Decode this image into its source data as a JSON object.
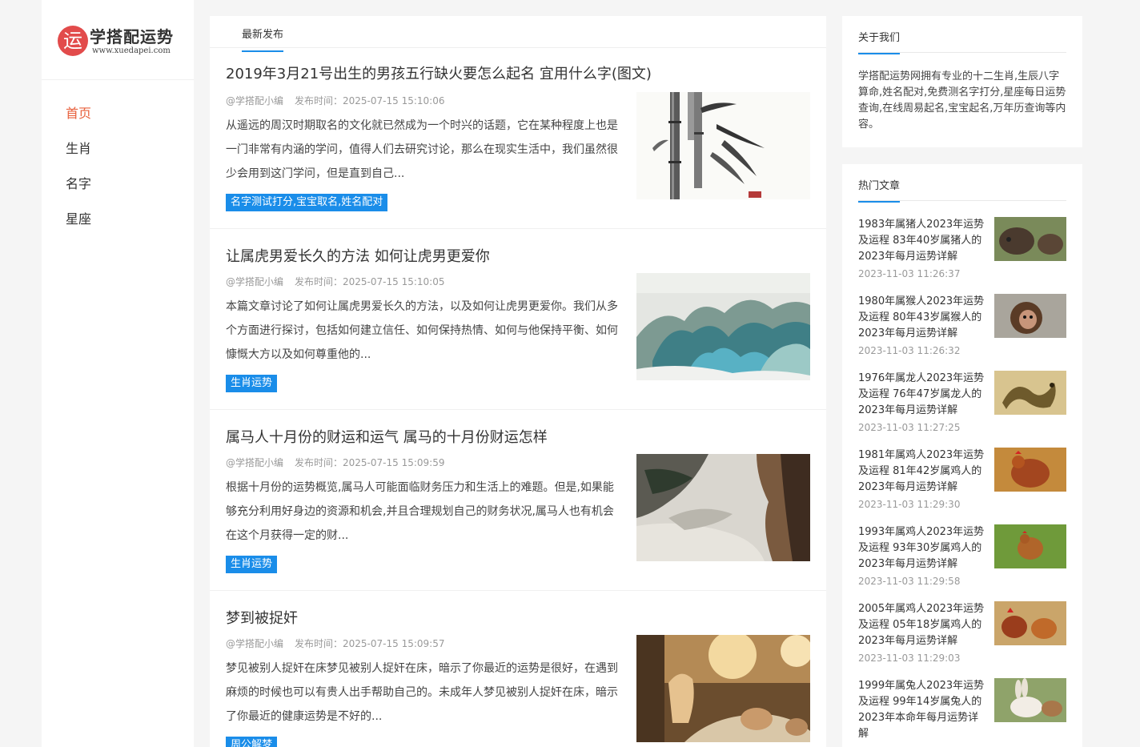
{
  "logo": {
    "badge": "运",
    "title": "学搭配运势",
    "subtitle": "www.xuedapei.com"
  },
  "nav": [
    {
      "label": "首页",
      "active": true
    },
    {
      "label": "生肖",
      "active": false
    },
    {
      "label": "名字",
      "active": false
    },
    {
      "label": "星座",
      "active": false
    }
  ],
  "main": {
    "tab": "最新发布",
    "articles": [
      {
        "title": "2019年3月21号出生的男孩五行缺火要怎么起名 宜用什么字(图文)",
        "author": "@学搭配小编",
        "time": "发布时间：2025-07-15 15:10:06",
        "excerpt": "从遥远的周汉时期取名的文化就已然成为一个时兴的话题，它在某种程度上也是一门非常有内涵的学问，值得人们去研究讨论，那么在现实生活中，我们虽然很少会用到这门学问，但是直到自己...",
        "tag": "名字测试打分,宝宝取名,姓名配对",
        "image": "bamboo-ink-painting"
      },
      {
        "title": "让属虎男爱长久的方法 如何让虎男更爱你",
        "author": "@学搭配小编",
        "time": "发布时间：2025-07-15 15:10:05",
        "excerpt": "本篇文章讨论了如何让属虎男爱长久的方法，以及如何让虎男更爱你。我们从多个方面进行探讨，包括如何建立信任、如何保持热情、如何与他保持平衡、如何慷慨大方以及如何尊重他的...",
        "tag": "生肖运势",
        "image": "blue-green-mountain-landscape"
      },
      {
        "title": "属马人十月份的财运和运气 属马的十月份财运怎样",
        "author": "@学搭配小编",
        "time": "发布时间：2025-07-15 15:09:59",
        "excerpt": "根据十月份的运势概览,属马人可能面临财务压力和生活上的难题。但是,如果能够充分利用好身边的资源和机会,并且合理规划自己的财务状况,属马人也有机会在这个月获得一定的财...",
        "tag": "生肖运势",
        "image": "ink-cliff-landscape"
      },
      {
        "title": "梦到被捉奸",
        "author": "@学搭配小编",
        "time": "发布时间：2025-07-15 15:09:57",
        "excerpt": "梦见被别人捉奸在床梦见被别人捉奸在床，暗示了你最近的运势是很好，在遇到麻烦的时候也可以有贵人出手帮助自己的。未成年人梦见被别人捉奸在床，暗示了你最近的健康运势是不好的...",
        "tag": "周公解梦",
        "image": "bedroom-photo"
      }
    ]
  },
  "about": {
    "heading": "关于我们",
    "text": "学搭配运势网拥有专业的十二生肖,生辰八字算命,姓名配对,免费测名字打分,星座每日运势查询,在线周易起名,宝宝起名,万年历查询等内容。"
  },
  "hot": {
    "heading": "热门文章",
    "items": [
      {
        "title": "1983年属猪人2023年运势及运程 83年40岁属猪人的2023年每月运势详解",
        "time": "2023-11-03 11:26:37",
        "image": "pigs"
      },
      {
        "title": "1980年属猴人2023年运势及运程 80年43岁属猴人的2023年每月运势详解",
        "time": "2023-11-03 11:26:32",
        "image": "monkey"
      },
      {
        "title": "1976年属龙人2023年运势及运程 76年47岁属龙人的2023年每月运势详解",
        "time": "2023-11-03 11:27:25",
        "image": "dragon"
      },
      {
        "title": "1981年属鸡人2023年运势及运程 81年42岁属鸡人的2023年每月运势详解",
        "time": "2023-11-03 11:29:30",
        "image": "hen"
      },
      {
        "title": "1993年属鸡人2023年运势及运程 93年30岁属鸡人的2023年每月运势详解",
        "time": "2023-11-03 11:29:58",
        "image": "hen-grass"
      },
      {
        "title": "2005年属鸡人2023年运势及运程 05年18岁属鸡人的2023年每月运势详解",
        "time": "2023-11-03 11:29:03",
        "image": "chickens"
      },
      {
        "title": "1999年属兔人2023年运势及运程 99年14岁属兔人的2023年本命年每月运势详解",
        "time": "",
        "image": "rabbits"
      }
    ]
  }
}
